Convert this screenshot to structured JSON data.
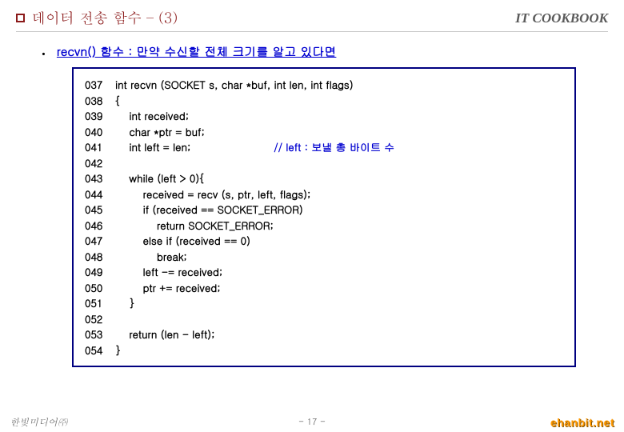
{
  "header": {
    "title": "데이터 전송 함수 – (3)",
    "brand": "IT COOKBOOK"
  },
  "sub": {
    "bullet": "•",
    "text": "recvn() 함수 : 만약 수신할 전체 크기를 알고 있다면"
  },
  "code": [
    {
      "ln": "037",
      "t": "int recvn (SOCKET s, char *buf, int len, int flags)"
    },
    {
      "ln": "038",
      "t": "{"
    },
    {
      "ln": "039",
      "t": "    int received;"
    },
    {
      "ln": "040",
      "t": "    char *ptr = buf;"
    },
    {
      "ln": "041",
      "t": "    int left = len;                        ",
      "c": "// left : 보낼 총 바이트 수"
    },
    {
      "ln": "042",
      "t": ""
    },
    {
      "ln": "043",
      "t": "    while (left > 0){"
    },
    {
      "ln": "044",
      "t": "        received = recv (s, ptr, left, flags);"
    },
    {
      "ln": "045",
      "t": "        if (received == SOCKET_ERROR)"
    },
    {
      "ln": "046",
      "t": "            return SOCKET_ERROR;"
    },
    {
      "ln": "047",
      "t": "        else if (received == 0)"
    },
    {
      "ln": "048",
      "t": "            break;"
    },
    {
      "ln": "049",
      "t": "        left -= received;"
    },
    {
      "ln": "050",
      "t": "        ptr += received;"
    },
    {
      "ln": "051",
      "t": "    }"
    },
    {
      "ln": "052",
      "t": ""
    },
    {
      "ln": "053",
      "t": "    return (len - left);"
    },
    {
      "ln": "054",
      "t": "}"
    }
  ],
  "footer": {
    "left": "한빛미디어㈜",
    "center": "- 17 -",
    "right": "ehanbit.net"
  }
}
